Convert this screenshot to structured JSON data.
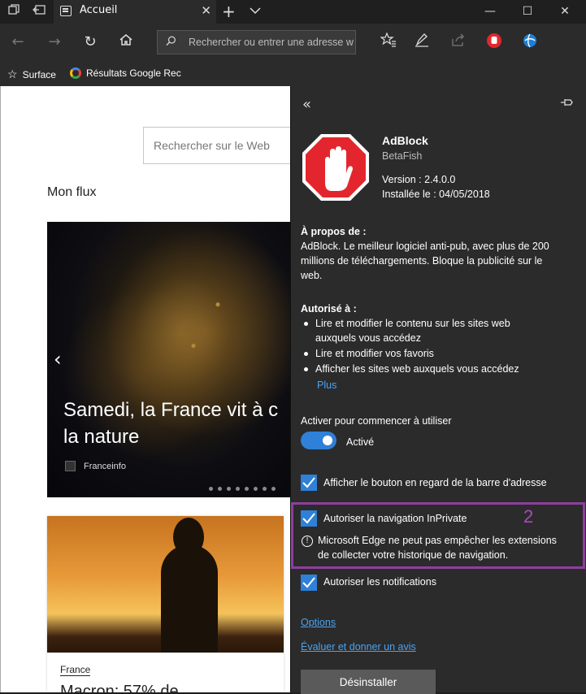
{
  "tab": {
    "title": "Accueil"
  },
  "address": {
    "placeholder": "Rechercher ou entrer une adresse w"
  },
  "favorites": [
    {
      "label": "Surface"
    },
    {
      "label": "Résultats Google Rec"
    }
  ],
  "page": {
    "search_placeholder": "Rechercher sur le Web",
    "feed_title": "Mon flux",
    "hero_headline_1": "Samedi, la France vit à c",
    "hero_headline_2": "la nature",
    "hero_source": "Franceinfo",
    "card2_tag": "France",
    "card2_title": "Macron: 57% de"
  },
  "panel": {
    "name": "AdBlock",
    "author": "BetaFish",
    "version": "Version : 2.4.0.0",
    "installed": "Installée le : 04/05/2018",
    "about_title": "À propos de :",
    "about_lines": [
      "AdBlock. Le meilleur logiciel anti-pub, avec plus de 200",
      "millions de téléchargements. Bloque la publicité sur le",
      "web."
    ],
    "authorized_title": "Autorisé à :",
    "permissions": [
      [
        "Lire et modifier le contenu sur les sites web",
        "auxquels vous accédez"
      ],
      [
        "Lire et modifier vos favoris"
      ],
      [
        "Afficher les sites web auxquels vous accédez"
      ]
    ],
    "more_link": "Plus",
    "activate_label": "Activer pour commencer à utiliser",
    "toggle_state": "Activé",
    "opt_show_button": "Afficher le bouton en regard de la barre d'adresse",
    "opt_inprivate": "Autoriser la navigation InPrivate",
    "annotation_number": "2",
    "warning_line_1": "Microsoft Edge ne peut pas empêcher les extensions",
    "warning_line_2": "de collecter votre historique de navigation.",
    "opt_notifications": "Autoriser les notifications",
    "options_link": "Options",
    "rate_link": "Évaluer et donner un avis",
    "uninstall": "Désinstaller",
    "accent_color": "#2f80d8",
    "highlight_color": "#8e3f9e"
  }
}
